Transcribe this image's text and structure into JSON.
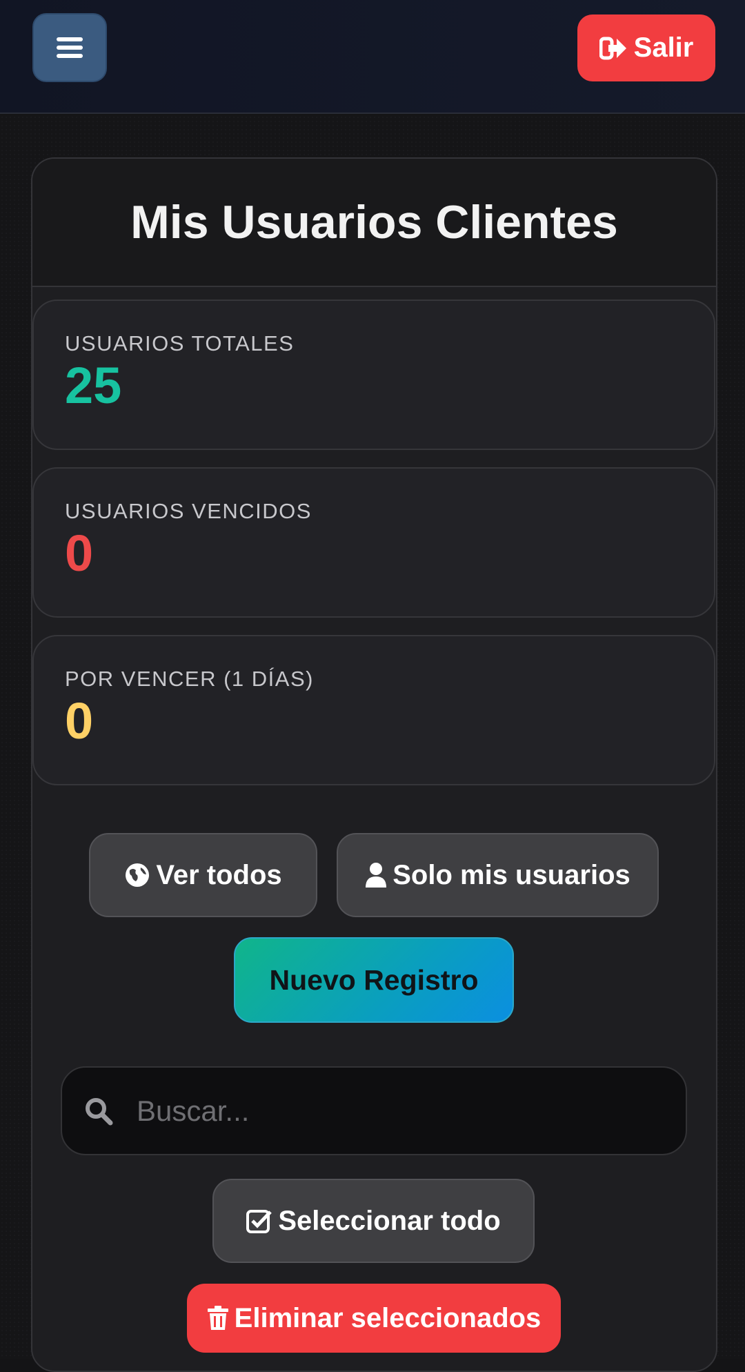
{
  "header": {
    "menu_icon": "hamburger-icon",
    "logout_label": "Salir",
    "logout_icon": "sign-out-icon"
  },
  "page": {
    "title": "Mis Usuarios Clientes"
  },
  "stats": [
    {
      "label": "USUARIOS TOTALES",
      "value": "25",
      "color": "#17c2a0"
    },
    {
      "label": "USUARIOS VENCIDOS",
      "value": "0",
      "color": "#ee4a4a"
    },
    {
      "label": "POR VENCER (1 DÍAS)",
      "value": "0",
      "color": "#ffd166"
    }
  ],
  "filters": {
    "all_label": "Ver todos",
    "all_icon": "globe-icon",
    "mine_label": "Solo mis usuarios",
    "mine_icon": "user-icon"
  },
  "actions": {
    "new_label": "Nuevo Registro",
    "select_all_label": "Seleccionar todo",
    "select_all_icon": "check-square-icon",
    "delete_label": "Eliminar seleccionados",
    "delete_icon": "trash-icon"
  },
  "search": {
    "placeholder": "Buscar...",
    "icon": "search-icon"
  },
  "colors": {
    "accent_red": "#f23d40",
    "menu_blue": "#3b5b80",
    "teal": "#17c2a0",
    "yellow": "#ffd166"
  }
}
